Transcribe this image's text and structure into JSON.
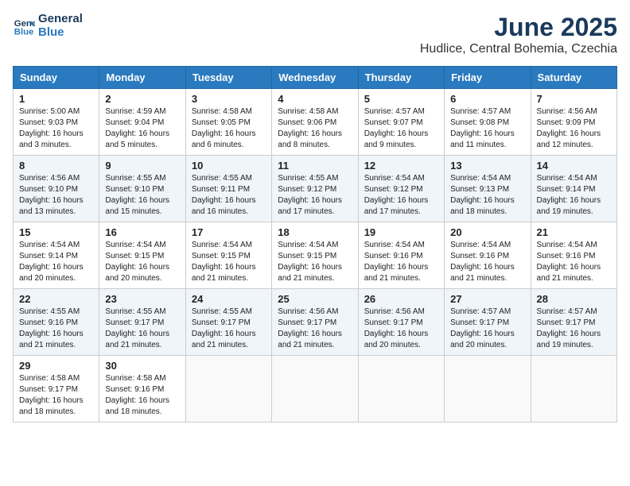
{
  "header": {
    "logo_line1": "General",
    "logo_line2": "Blue",
    "month": "June 2025",
    "location": "Hudlice, Central Bohemia, Czechia"
  },
  "weekdays": [
    "Sunday",
    "Monday",
    "Tuesday",
    "Wednesday",
    "Thursday",
    "Friday",
    "Saturday"
  ],
  "weeks": [
    [
      {
        "day": "1",
        "info": "Sunrise: 5:00 AM\nSunset: 9:03 PM\nDaylight: 16 hours\nand 3 minutes."
      },
      {
        "day": "2",
        "info": "Sunrise: 4:59 AM\nSunset: 9:04 PM\nDaylight: 16 hours\nand 5 minutes."
      },
      {
        "day": "3",
        "info": "Sunrise: 4:58 AM\nSunset: 9:05 PM\nDaylight: 16 hours\nand 6 minutes."
      },
      {
        "day": "4",
        "info": "Sunrise: 4:58 AM\nSunset: 9:06 PM\nDaylight: 16 hours\nand 8 minutes."
      },
      {
        "day": "5",
        "info": "Sunrise: 4:57 AM\nSunset: 9:07 PM\nDaylight: 16 hours\nand 9 minutes."
      },
      {
        "day": "6",
        "info": "Sunrise: 4:57 AM\nSunset: 9:08 PM\nDaylight: 16 hours\nand 11 minutes."
      },
      {
        "day": "7",
        "info": "Sunrise: 4:56 AM\nSunset: 9:09 PM\nDaylight: 16 hours\nand 12 minutes."
      }
    ],
    [
      {
        "day": "8",
        "info": "Sunrise: 4:56 AM\nSunset: 9:10 PM\nDaylight: 16 hours\nand 13 minutes."
      },
      {
        "day": "9",
        "info": "Sunrise: 4:55 AM\nSunset: 9:10 PM\nDaylight: 16 hours\nand 15 minutes."
      },
      {
        "day": "10",
        "info": "Sunrise: 4:55 AM\nSunset: 9:11 PM\nDaylight: 16 hours\nand 16 minutes."
      },
      {
        "day": "11",
        "info": "Sunrise: 4:55 AM\nSunset: 9:12 PM\nDaylight: 16 hours\nand 17 minutes."
      },
      {
        "day": "12",
        "info": "Sunrise: 4:54 AM\nSunset: 9:12 PM\nDaylight: 16 hours\nand 17 minutes."
      },
      {
        "day": "13",
        "info": "Sunrise: 4:54 AM\nSunset: 9:13 PM\nDaylight: 16 hours\nand 18 minutes."
      },
      {
        "day": "14",
        "info": "Sunrise: 4:54 AM\nSunset: 9:14 PM\nDaylight: 16 hours\nand 19 minutes."
      }
    ],
    [
      {
        "day": "15",
        "info": "Sunrise: 4:54 AM\nSunset: 9:14 PM\nDaylight: 16 hours\nand 20 minutes."
      },
      {
        "day": "16",
        "info": "Sunrise: 4:54 AM\nSunset: 9:15 PM\nDaylight: 16 hours\nand 20 minutes."
      },
      {
        "day": "17",
        "info": "Sunrise: 4:54 AM\nSunset: 9:15 PM\nDaylight: 16 hours\nand 21 minutes."
      },
      {
        "day": "18",
        "info": "Sunrise: 4:54 AM\nSunset: 9:15 PM\nDaylight: 16 hours\nand 21 minutes."
      },
      {
        "day": "19",
        "info": "Sunrise: 4:54 AM\nSunset: 9:16 PM\nDaylight: 16 hours\nand 21 minutes."
      },
      {
        "day": "20",
        "info": "Sunrise: 4:54 AM\nSunset: 9:16 PM\nDaylight: 16 hours\nand 21 minutes."
      },
      {
        "day": "21",
        "info": "Sunrise: 4:54 AM\nSunset: 9:16 PM\nDaylight: 16 hours\nand 21 minutes."
      }
    ],
    [
      {
        "day": "22",
        "info": "Sunrise: 4:55 AM\nSunset: 9:16 PM\nDaylight: 16 hours\nand 21 minutes."
      },
      {
        "day": "23",
        "info": "Sunrise: 4:55 AM\nSunset: 9:17 PM\nDaylight: 16 hours\nand 21 minutes."
      },
      {
        "day": "24",
        "info": "Sunrise: 4:55 AM\nSunset: 9:17 PM\nDaylight: 16 hours\nand 21 minutes."
      },
      {
        "day": "25",
        "info": "Sunrise: 4:56 AM\nSunset: 9:17 PM\nDaylight: 16 hours\nand 21 minutes."
      },
      {
        "day": "26",
        "info": "Sunrise: 4:56 AM\nSunset: 9:17 PM\nDaylight: 16 hours\nand 20 minutes."
      },
      {
        "day": "27",
        "info": "Sunrise: 4:57 AM\nSunset: 9:17 PM\nDaylight: 16 hours\nand 20 minutes."
      },
      {
        "day": "28",
        "info": "Sunrise: 4:57 AM\nSunset: 9:17 PM\nDaylight: 16 hours\nand 19 minutes."
      }
    ],
    [
      {
        "day": "29",
        "info": "Sunrise: 4:58 AM\nSunset: 9:17 PM\nDaylight: 16 hours\nand 18 minutes."
      },
      {
        "day": "30",
        "info": "Sunrise: 4:58 AM\nSunset: 9:16 PM\nDaylight: 16 hours\nand 18 minutes."
      },
      {
        "day": "",
        "info": ""
      },
      {
        "day": "",
        "info": ""
      },
      {
        "day": "",
        "info": ""
      },
      {
        "day": "",
        "info": ""
      },
      {
        "day": "",
        "info": ""
      }
    ]
  ]
}
